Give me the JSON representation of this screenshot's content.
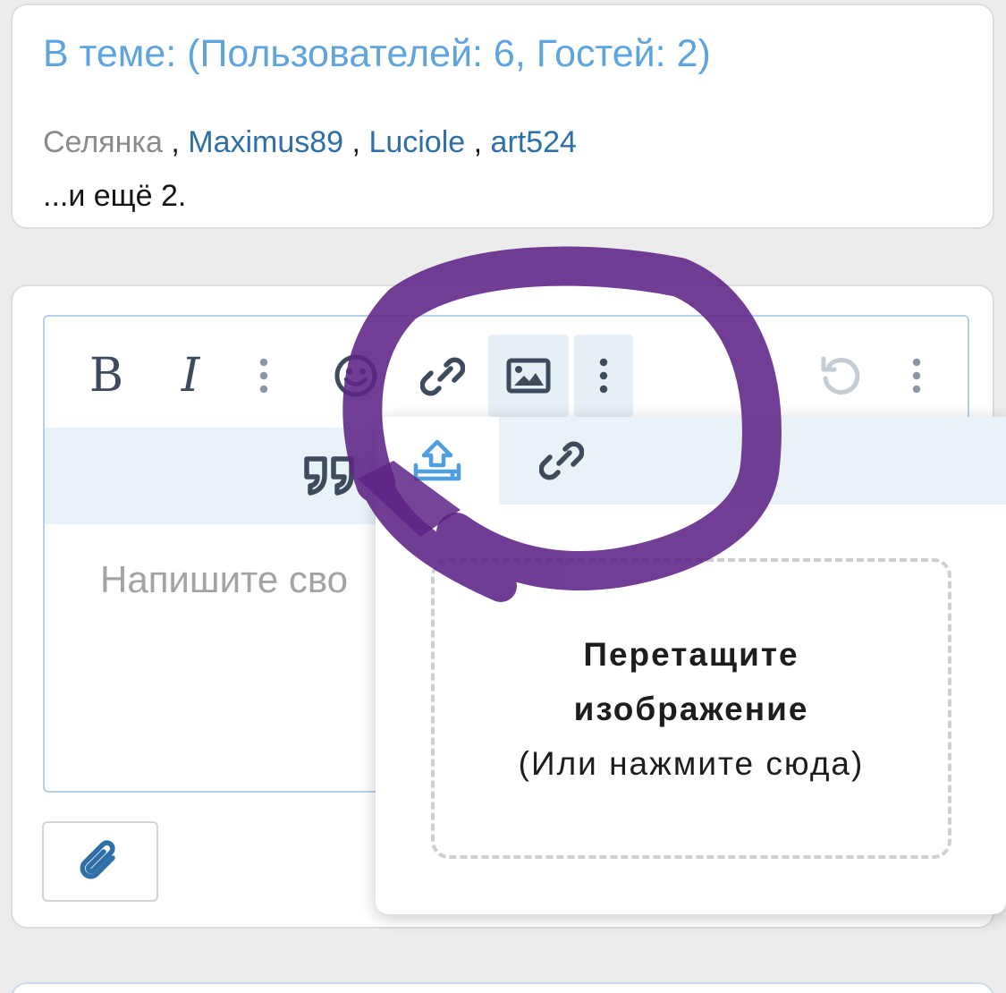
{
  "online": {
    "title": "В теме: (Пользователей: 6, Гостей: 2)",
    "users": [
      "Селянка",
      "Maximus89",
      "Luciole",
      "art524"
    ],
    "separator": " , ",
    "more": "...и ещё 2."
  },
  "editor": {
    "toolbar_primary": [
      {
        "icon": "bold-icon",
        "label": "B"
      },
      {
        "icon": "italic-icon",
        "label": "I"
      },
      {
        "icon": "more-text-options-icon"
      },
      {
        "icon": "smiley-icon"
      },
      {
        "icon": "link-icon"
      },
      {
        "icon": "image-icon",
        "active": true
      },
      {
        "icon": "more-insert-options-icon",
        "active": true
      },
      {
        "icon": "undo-icon",
        "disabled": true
      },
      {
        "icon": "more-options-icon"
      }
    ],
    "toolbar_secondary": [
      {
        "icon": "quote-icon"
      }
    ],
    "placeholder": "Напишите сво",
    "attach_icon": "paperclip-icon"
  },
  "image_popup": {
    "tabs": [
      {
        "icon": "upload-icon",
        "active": true
      },
      {
        "icon": "link-icon",
        "active": false
      }
    ],
    "dropzone_title_line1": "Перетащите",
    "dropzone_title_line2": "изображение",
    "dropzone_hint": "(Или нажмите сюда)"
  },
  "colors": {
    "accent": "#5ea4df",
    "link": "#2f6fa7",
    "icon": "#49586a",
    "toolbar_bg": "#e9f1f9",
    "annotation": "#5e2386"
  }
}
